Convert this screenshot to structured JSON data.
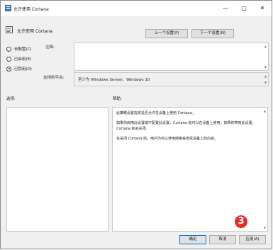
{
  "window": {
    "title": "允许使用 Cortana",
    "controls": {
      "minimize": "—",
      "maximize": "□",
      "close": "✕"
    }
  },
  "policy": {
    "name": "允许使用 Cortana"
  },
  "nav": {
    "prev_label": "上一个设置(P)",
    "next_label": "下一个设置(N)"
  },
  "state": {
    "options": [
      {
        "label": "未配置(C)",
        "checked": false
      },
      {
        "label": "已启用(E)",
        "checked": false
      },
      {
        "label": "已禁用(D)",
        "checked": true
      }
    ],
    "selected": "已禁用(D)"
  },
  "comment": {
    "label": "注释:",
    "value": ""
  },
  "supported": {
    "label": "支持的平台:",
    "value": "至少为 Windows Server、Windows 10"
  },
  "options_pane": {
    "label": "选项:"
  },
  "help": {
    "label": "帮助:",
    "paragraphs": [
      "此策略设置指定是否允许在设备上使用 Cortana。",
      "如果你启用此设置或不配置此设置，Cortana 就可以在设备上使用。如果你禁用此设置，Cortana 就会关闭。",
      "在关闭 Cortana 后，用户仍可以使用搜索来查找设备上的内容。"
    ]
  },
  "annotation": {
    "badge": "3"
  },
  "footer": {
    "ok_label": "确定",
    "cancel_label": "取消",
    "apply_label": "应用(A)"
  },
  "colors": {
    "accent": "#0078d7",
    "badge": "#e0302b",
    "window_bg": "#f0f0f0"
  }
}
